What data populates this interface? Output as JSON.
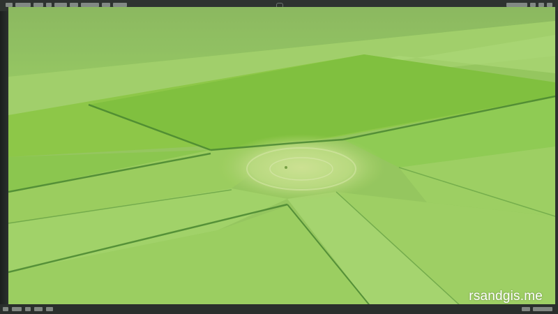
{
  "watermark": {
    "text": "rsandgis.me"
  },
  "scene": {
    "subject": "aerial-field-landscape",
    "colors": {
      "field_light": "#a9d36a",
      "field_mid": "#86c049",
      "field_dark": "#5fae33",
      "hedge": "#3f7d25",
      "far_field": "#8fbf63"
    }
  },
  "icons": {
    "top_left": "window-title-icon",
    "top_right": "window-controls-icon",
    "bottom_left": "taskbar-icons",
    "bottom_right": "tray-icons"
  }
}
